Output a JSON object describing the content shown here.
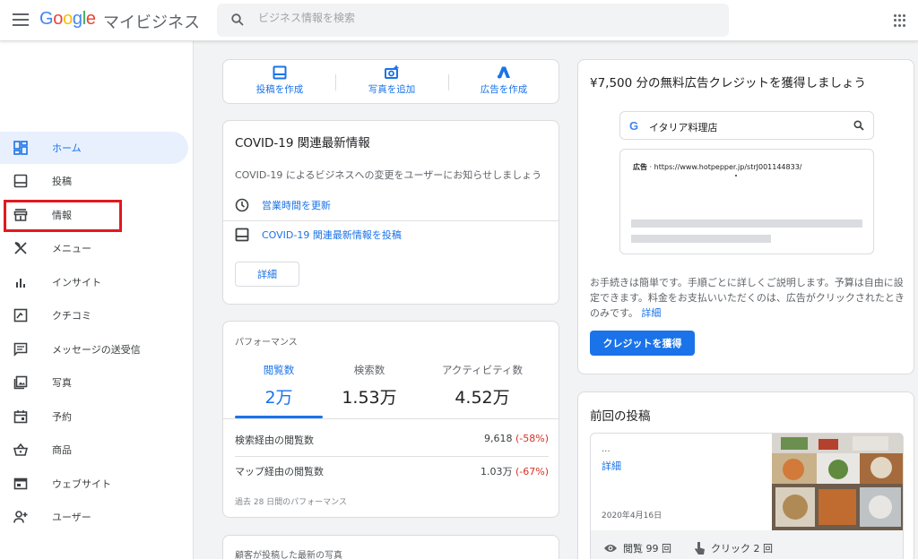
{
  "header": {
    "logo": [
      "G",
      "o",
      "o",
      "g",
      "l",
      "e"
    ],
    "product": "マイビジネス",
    "search_placeholder": "ビジネス情報を検索"
  },
  "sidebar": {
    "items": [
      {
        "label": "ホーム",
        "icon": "dashboard-icon",
        "active": true
      },
      {
        "label": "投稿",
        "icon": "post-icon"
      },
      {
        "label": "情報",
        "icon": "storefront-icon",
        "highlighted": true
      },
      {
        "label": "メニュー",
        "icon": "restaurant-menu-icon"
      },
      {
        "label": "インサイト",
        "icon": "insights-bar-icon"
      },
      {
        "label": "クチコミ",
        "icon": "review-icon"
      },
      {
        "label": "メッセージの送受信",
        "icon": "message-icon"
      },
      {
        "label": "写真",
        "icon": "photo-icon"
      },
      {
        "label": "予約",
        "icon": "calendar-icon"
      },
      {
        "label": "商品",
        "icon": "shopping-basket-icon"
      },
      {
        "label": "ウェブサイト",
        "icon": "website-icon"
      },
      {
        "label": "ユーザー",
        "icon": "add-user-icon"
      }
    ],
    "highlight_color": "#e0191f"
  },
  "actions": [
    {
      "label": "投稿を作成",
      "icon": "post-icon"
    },
    {
      "label": "写真を追加",
      "icon": "add-photo-icon"
    },
    {
      "label": "広告を作成",
      "icon": "google-ads-icon"
    }
  ],
  "covid": {
    "title": "COVID-19 関連最新情報",
    "subtitle": "COVID-19 によるビジネスへの変更をユーザーにお知らせしましょう",
    "link_hours": "営業時間を更新",
    "link_post": "COVID-19 関連最新情報を投稿",
    "details": "詳細"
  },
  "performance": {
    "label": "パフォーマンス",
    "stats": [
      {
        "name": "閲覧数",
        "value": "2万",
        "active": true
      },
      {
        "name": "検索数",
        "value": "1.53万"
      },
      {
        "name": "アクティビティ数",
        "value": "4.52万"
      }
    ],
    "rows": [
      {
        "label": "検索経由の閲覧数",
        "value": "9,618",
        "change": "(-58%)"
      },
      {
        "label": "マップ経由の閲覧数",
        "value": "1.03万",
        "change": "(-67%)"
      }
    ],
    "footer": "過去 28 日間のパフォーマンス"
  },
  "photos_card": {
    "label": "顧客が投稿した最新の写真"
  },
  "ads": {
    "title": "¥7,500 分の無料広告クレジットを獲得しましょう",
    "mock_query": "イタリア料理店",
    "mock_ad_label": "広告",
    "mock_ad_url": "https://www.hotpepper.jp/strJ001144833/",
    "description": "お手続きは簡単です。手順ごとに詳しくご説明します。予算は自由に設定できます。料金をお支払いいただくのは、広告がクリックされたときのみです。",
    "more_link": "詳細",
    "button": "クレジットを獲得"
  },
  "last_post": {
    "title": "前回の投稿",
    "ellipsis": "...",
    "more": "詳細",
    "date": "2020年4月16日",
    "views": "閲覧 99 回",
    "clicks": "クリック 2 回"
  },
  "colors": {
    "accent": "#1a73e8",
    "negative": "#d93025"
  }
}
